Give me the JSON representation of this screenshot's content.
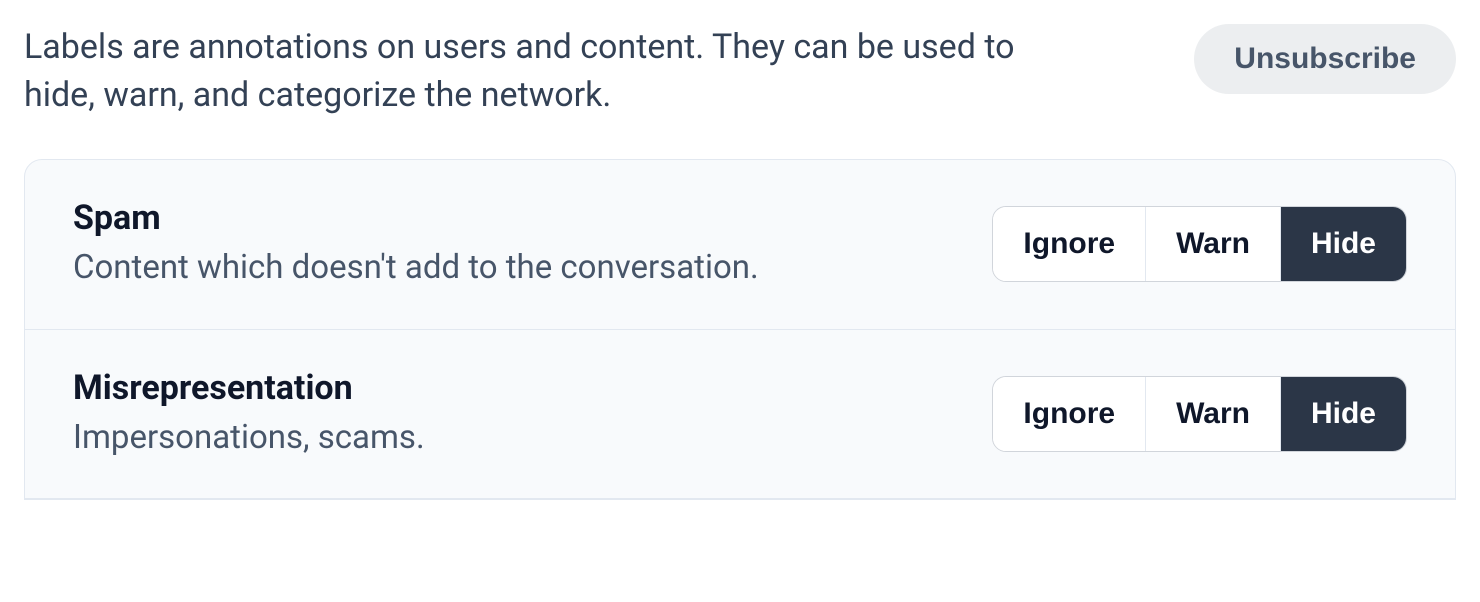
{
  "header": {
    "description": "Labels are annotations on users and content. They can be used to hide, warn, and categorize the network.",
    "unsubscribe_label": "Unsubscribe"
  },
  "toggle_options": {
    "ignore": "Ignore",
    "warn": "Warn",
    "hide": "Hide"
  },
  "labels": [
    {
      "title": "Spam",
      "description": "Content which doesn't add to the conversation.",
      "selected": "hide"
    },
    {
      "title": "Misrepresentation",
      "description": "Impersonations, scams.",
      "selected": "hide"
    }
  ]
}
